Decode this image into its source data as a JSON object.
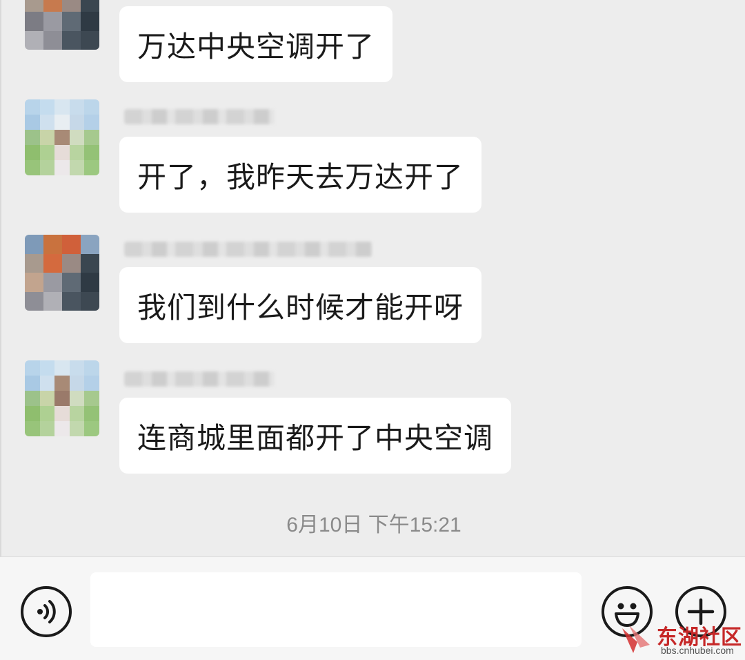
{
  "messages": [
    {
      "text": "万达中央空调开了"
    },
    {
      "text": "开了，我昨天去万达开了"
    },
    {
      "text": "我们到什么时候才能开呀"
    },
    {
      "text": "连商城里面都开了中央空调"
    }
  ],
  "timestamp": "6月10日 下午15:21",
  "input": {
    "value": ""
  },
  "icons": {
    "voice": "voice-icon",
    "emoji": "emoji-icon",
    "more": "plus-icon"
  },
  "watermark": {
    "title": "东湖社区",
    "url": "bbs.cnhubei.com"
  },
  "colors": {
    "background": "#ededed",
    "bubble": "#ffffff",
    "timestamp": "#8a8a8a",
    "watermark": "#c62828"
  }
}
